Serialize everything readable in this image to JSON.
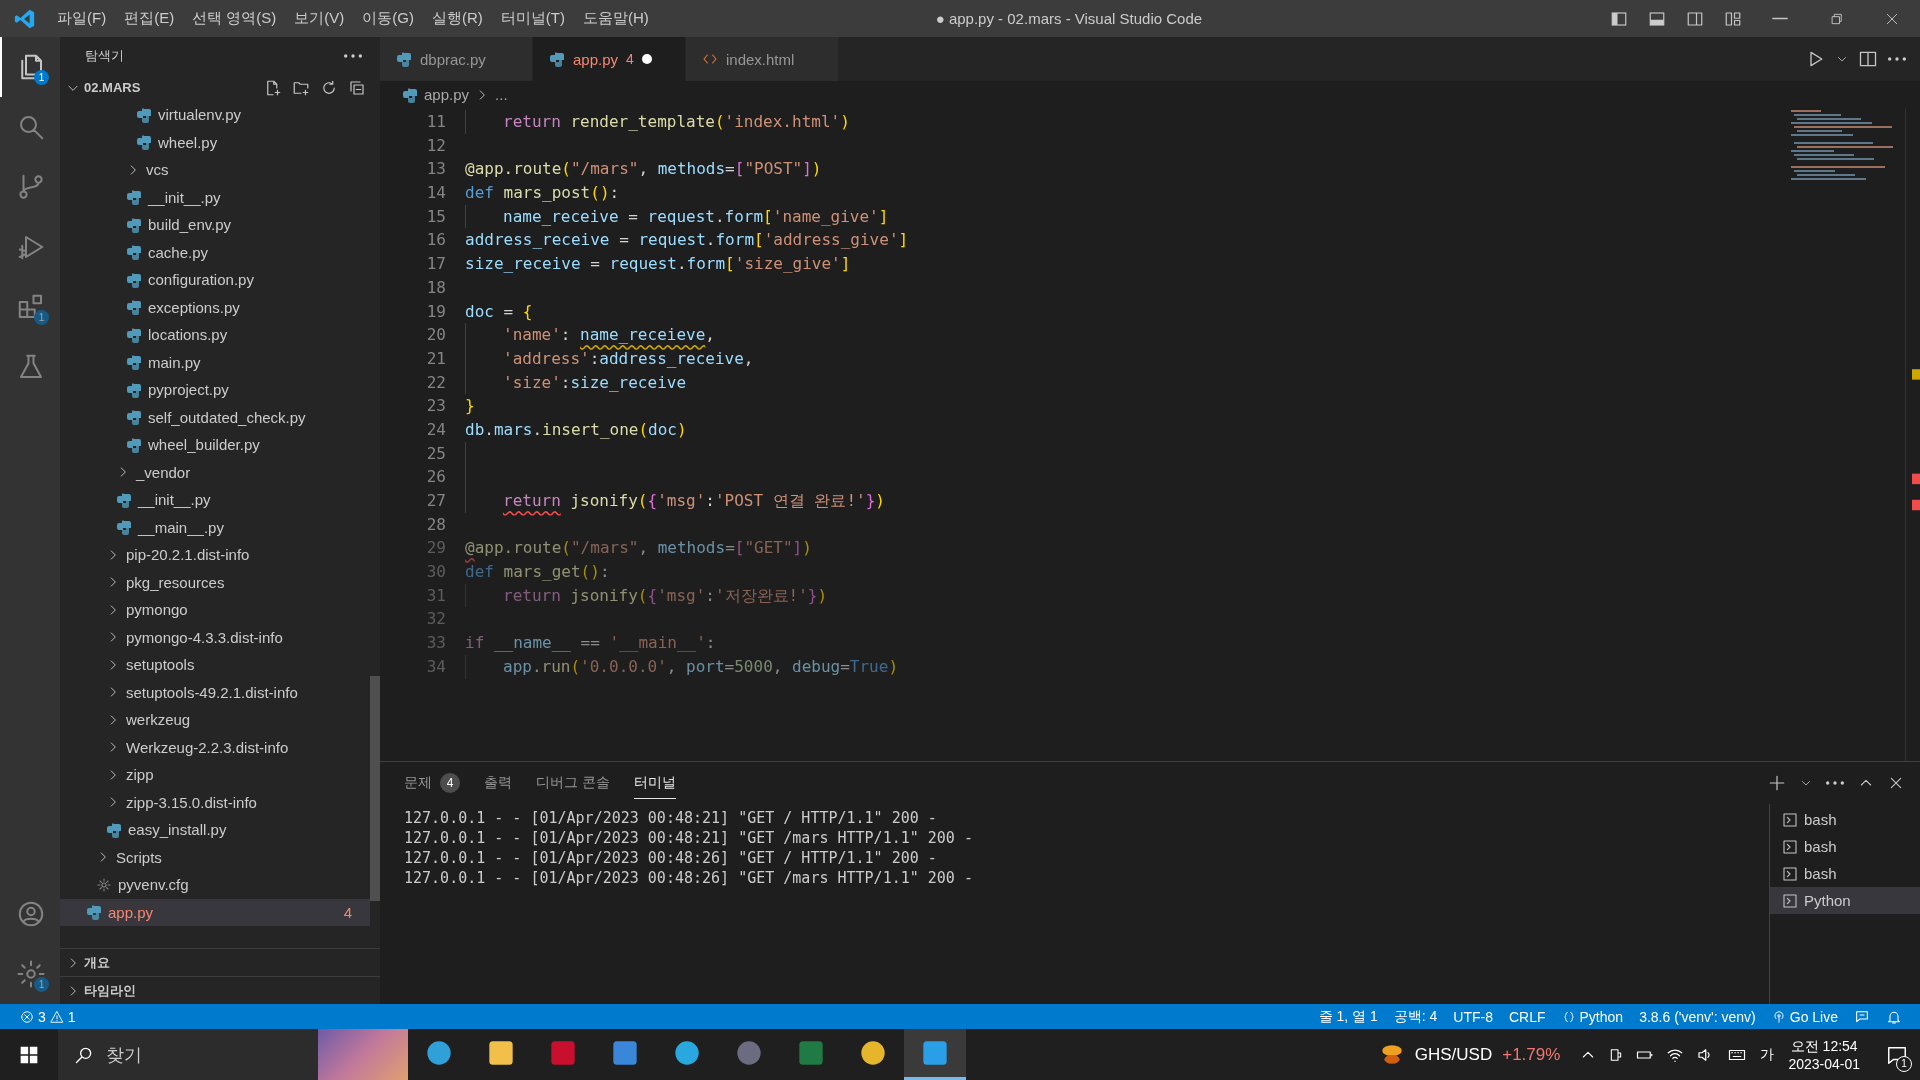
{
  "title_bar": {
    "menus": [
      "파일(F)",
      "편집(E)",
      "선택 영역(S)",
      "보기(V)",
      "이동(G)",
      "실행(R)",
      "터미널(T)",
      "도움말(H)"
    ],
    "title": "● app.py - 02.mars - Visual Studio Code"
  },
  "activity_bar": [
    {
      "kind": "explorer",
      "selected": true,
      "badge": "1"
    },
    {
      "kind": "search",
      "selected": false
    },
    {
      "kind": "source-control",
      "selected": false
    },
    {
      "kind": "run",
      "selected": false
    },
    {
      "kind": "extensions",
      "selected": false,
      "badge": "1"
    },
    {
      "kind": "testing",
      "selected": false
    }
  ],
  "activity_bar_bottom": [
    {
      "kind": "accounts"
    },
    {
      "kind": "manage",
      "badge": "1"
    }
  ],
  "explorer": {
    "title": "탐색기",
    "folder": "02.MARS",
    "tree": [
      {
        "children": [
          {
            "children": [
              {
                "children": [
                  {
                    "children": [
                      {
                        "children": [
                          {
                            "label": "virtualenv.py",
                            "kind": "python",
                            "selected": false
                          },
                          {
                            "label": "wheel.py",
                            "kind": "python",
                            "selected": false
                          }
                        ]
                      },
                      {
                        "label": "vcs",
                        "kind": "folder",
                        "selected": false
                      },
                      {
                        "label": "__init__.py",
                        "kind": "python",
                        "selected": false
                      },
                      {
                        "label": "build_env.py",
                        "kind": "python",
                        "selected": false
                      },
                      {
                        "label": "cache.py",
                        "kind": "python",
                        "selected": false
                      },
                      {
                        "label": "configuration.py",
                        "kind": "python",
                        "selected": false
                      },
                      {
                        "label": "exceptions.py",
                        "kind": "python",
                        "selected": false
                      },
                      {
                        "label": "locations.py",
                        "kind": "python",
                        "selected": false
                      },
                      {
                        "label": "main.py",
                        "kind": "python",
                        "selected": false
                      },
                      {
                        "label": "pyproject.py",
                        "kind": "python",
                        "selected": false
                      },
                      {
                        "label": "self_outdated_check.py",
                        "kind": "python",
                        "selected": false
                      },
                      {
                        "label": "wheel_builder.py",
                        "kind": "python",
                        "selected": false
                      }
                    ]
                  },
                  {
                    "label": "_vendor",
                    "kind": "folder",
                    "selected": false
                  },
                  {
                    "label": "__init__.py",
                    "kind": "python",
                    "selected": false
                  },
                  {
                    "label": "__main__.py",
                    "kind": "python",
                    "selected": false
                  }
                ]
              },
              {
                "label": "pip-20.2.1.dist-info",
                "kind": "folder",
                "selected": false
              },
              {
                "label": "pkg_resources",
                "kind": "folder",
                "selected": false
              },
              {
                "label": "pymongo",
                "kind": "folder",
                "selected": false
              },
              {
                "label": "pymongo-4.3.3.dist-info",
                "kind": "folder",
                "selected": false
              },
              {
                "label": "setuptools",
                "kind": "folder",
                "selected": false
              },
              {
                "label": "setuptools-49.2.1.dist-info",
                "kind": "folder",
                "selected": false
              },
              {
                "label": "werkzeug",
                "kind": "folder",
                "selected": false
              },
              {
                "label": "Werkzeug-2.2.3.dist-info",
                "kind": "folder",
                "selected": false
              },
              {
                "label": "zipp",
                "kind": "folder",
                "selected": false
              },
              {
                "label": "zipp-3.15.0.dist-info",
                "kind": "folder",
                "selected": false
              },
              {
                "label": "easy_install.py",
                "kind": "python",
                "selected": false
              }
            ]
          },
          {
            "label": "Scripts",
            "kind": "folder",
            "selected": false
          },
          {
            "label": "pyvenv.cfg",
            "kind": "config",
            "selected": false
          }
        ]
      },
      {
        "label": "app.py",
        "kind": "python",
        "selected": true,
        "badge": "4"
      }
    ],
    "sections": [
      "개요",
      "타임라인"
    ]
  },
  "tabs": [
    {
      "label": "dbprac.py",
      "kind": "python",
      "selected": false,
      "modified": false
    },
    {
      "label": "app.py",
      "kind": "python",
      "selected": true,
      "modified": true,
      "problems": "4"
    },
    {
      "label": "index.html",
      "kind": "html",
      "selected": false,
      "modified": false
    }
  ],
  "breadcrumb": [
    "app.py",
    "..."
  ],
  "code": [
    {
      "number": "11",
      "indented": true,
      "dimmed": false,
      "tokens": [
        {
          "text": "return",
          "kind": "control"
        },
        {
          "text": " render_template",
          "kind": "function"
        },
        {
          "text": "(",
          "kind": "bracket1"
        },
        {
          "text": "'index.html'",
          "kind": "string"
        },
        {
          "text": ")",
          "kind": "bracket1"
        }
      ]
    },
    {
      "number": "12",
      "indented": false,
      "dimmed": false
    },
    {
      "number": "13",
      "indented": false,
      "dimmed": false,
      "tokens": [
        {
          "text": "@app.route",
          "kind": "function"
        },
        {
          "text": "(",
          "kind": "bracket1"
        },
        {
          "text": "\"/mars\"",
          "kind": "string"
        },
        {
          "text": ", ",
          "kind": "plain"
        },
        {
          "text": "methods",
          "kind": "variable"
        },
        {
          "text": "=",
          "kind": "plain"
        },
        {
          "text": "[",
          "kind": "bracket2"
        },
        {
          "text": "\"POST\"",
          "kind": "string"
        },
        {
          "text": "]",
          "kind": "bracket2"
        },
        {
          "text": ")",
          "kind": "bracket1"
        }
      ]
    },
    {
      "number": "14",
      "indented": false,
      "dimmed": false,
      "tokens": [
        {
          "text": "def",
          "kind": "keyword"
        },
        {
          "text": " mars_post",
          "kind": "function"
        },
        {
          "text": "(",
          "kind": "bracket1"
        },
        {
          "text": ")",
          "kind": "bracket1"
        },
        {
          "text": ":",
          "kind": "plain"
        }
      ]
    },
    {
      "number": "15",
      "indented": true,
      "dimmed": false,
      "tokens": [
        {
          "text": "name_receive",
          "kind": "variable"
        },
        {
          "text": " = ",
          "kind": "plain"
        },
        {
          "text": "request",
          "kind": "variable"
        },
        {
          "text": ".",
          "kind": "plain"
        },
        {
          "text": "form",
          "kind": "variable"
        },
        {
          "text": "[",
          "kind": "bracket1"
        },
        {
          "text": "'name_give'",
          "kind": "string"
        },
        {
          "text": "]",
          "kind": "bracket1"
        }
      ]
    },
    {
      "number": "16",
      "indented": false,
      "dimmed": false,
      "tokens": [
        {
          "text": "address_receive",
          "kind": "variable"
        },
        {
          "text": " = ",
          "kind": "plain"
        },
        {
          "text": "request",
          "kind": "variable"
        },
        {
          "text": ".",
          "kind": "plain"
        },
        {
          "text": "form",
          "kind": "variable"
        },
        {
          "text": "[",
          "kind": "bracket1"
        },
        {
          "text": "'address_give'",
          "kind": "string"
        },
        {
          "text": "]",
          "kind": "bracket1"
        }
      ]
    },
    {
      "number": "17",
      "indented": false,
      "dimmed": false,
      "tokens": [
        {
          "text": "size_receive",
          "kind": "variable"
        },
        {
          "text": " = ",
          "kind": "plain"
        },
        {
          "text": "request",
          "kind": "variable"
        },
        {
          "text": ".",
          "kind": "plain"
        },
        {
          "text": "form",
          "kind": "variable"
        },
        {
          "text": "[",
          "kind": "bracket1"
        },
        {
          "text": "'size_give'",
          "kind": "string"
        },
        {
          "text": "]",
          "kind": "bracket1"
        }
      ]
    },
    {
      "number": "18",
      "indented": false,
      "dimmed": false
    },
    {
      "number": "19",
      "indented": false,
      "dimmed": false,
      "tokens": [
        {
          "text": "doc",
          "kind": "variable"
        },
        {
          "text": " = ",
          "kind": "plain"
        },
        {
          "text": "{",
          "kind": "bracket1"
        }
      ]
    },
    {
      "number": "20",
      "indented": true,
      "dimmed": false,
      "tokens": [
        {
          "text": "'name'",
          "kind": "string"
        },
        {
          "text": ": ",
          "kind": "plain"
        },
        {
          "text": "name_receieve",
          "kind": "variable",
          "warning": true
        },
        {
          "text": ",",
          "kind": "plain"
        }
      ]
    },
    {
      "number": "21",
      "indented": true,
      "dimmed": false,
      "tokens": [
        {
          "text": "'address'",
          "kind": "string"
        },
        {
          "text": ":",
          "kind": "plain"
        },
        {
          "text": "address_receive",
          "kind": "variable"
        },
        {
          "text": ",",
          "kind": "plain"
        }
      ]
    },
    {
      "number": "22",
      "indented": true,
      "dimmed": false,
      "tokens": [
        {
          "text": "'size'",
          "kind": "string"
        },
        {
          "text": ":",
          "kind": "plain"
        },
        {
          "text": "size_receive",
          "kind": "variable"
        }
      ]
    },
    {
      "number": "23",
      "indented": false,
      "dimmed": false,
      "tokens": [
        {
          "text": "}",
          "kind": "bracket1"
        }
      ]
    },
    {
      "number": "24",
      "indented": false,
      "dimmed": false,
      "tokens": [
        {
          "text": "db",
          "kind": "variable"
        },
        {
          "text": ".",
          "kind": "plain"
        },
        {
          "text": "mars",
          "kind": "variable"
        },
        {
          "text": ".",
          "kind": "plain"
        },
        {
          "text": "insert_one",
          "kind": "function"
        },
        {
          "text": "(",
          "kind": "bracket1"
        },
        {
          "text": "doc",
          "kind": "variable"
        },
        {
          "text": ")",
          "kind": "bracket1"
        }
      ]
    },
    {
      "number": "25",
      "indented": true,
      "dimmed": false
    },
    {
      "number": "26",
      "indented": true,
      "dimmed": false
    },
    {
      "number": "27",
      "indented": true,
      "dimmed": false,
      "tokens": [
        {
          "text": "return",
          "kind": "control",
          "error": true
        },
        {
          "text": " jsonify",
          "kind": "function"
        },
        {
          "text": "(",
          "kind": "bracket1"
        },
        {
          "text": "{",
          "kind": "bracket2"
        },
        {
          "text": "'msg'",
          "kind": "string"
        },
        {
          "text": ":",
          "kind": "plain"
        },
        {
          "text": "'POST 연결 완료!'",
          "kind": "string"
        },
        {
          "text": "}",
          "kind": "bracket2"
        },
        {
          "text": ")",
          "kind": "bracket1"
        }
      ]
    },
    {
      "number": "28",
      "indented": false,
      "dimmed": false
    },
    {
      "number": "29",
      "indented": false,
      "dimmed": true,
      "tokens": [
        {
          "text": "@",
          "kind": "function",
          "error": true
        },
        {
          "text": "app.route",
          "kind": "function"
        },
        {
          "text": "(",
          "kind": "bracket1"
        },
        {
          "text": "\"/mars\"",
          "kind": "string"
        },
        {
          "text": ", ",
          "kind": "plain"
        },
        {
          "text": "methods",
          "kind": "variable"
        },
        {
          "text": "=",
          "kind": "plain"
        },
        {
          "text": "[",
          "kind": "bracket2"
        },
        {
          "text": "\"GET\"",
          "kind": "string"
        },
        {
          "text": "]",
          "kind": "bracket2"
        },
        {
          "text": ")",
          "kind": "bracket1"
        }
      ]
    },
    {
      "number": "30",
      "indented": false,
      "dimmed": true,
      "tokens": [
        {
          "text": "def",
          "kind": "keyword"
        },
        {
          "text": " mars_get",
          "kind": "function"
        },
        {
          "text": "(",
          "kind": "bracket1"
        },
        {
          "text": ")",
          "kind": "bracket1"
        },
        {
          "text": ":",
          "kind": "plain"
        }
      ]
    },
    {
      "number": "31",
      "indented": true,
      "dimmed": true,
      "tokens": [
        {
          "text": "return",
          "kind": "control"
        },
        {
          "text": " jsonify",
          "kind": "function"
        },
        {
          "text": "(",
          "kind": "bracket1"
        },
        {
          "text": "{",
          "kind": "bracket2"
        },
        {
          "text": "'msg'",
          "kind": "string"
        },
        {
          "text": ":",
          "kind": "plain"
        },
        {
          "text": "'저장완료!'",
          "kind": "string"
        },
        {
          "text": "}",
          "kind": "bracket2"
        },
        {
          "text": ")",
          "kind": "bracket1"
        }
      ]
    },
    {
      "number": "32",
      "indented": false,
      "dimmed": true
    },
    {
      "number": "33",
      "indented": false,
      "dimmed": true,
      "tokens": [
        {
          "text": "if",
          "kind": "control"
        },
        {
          "text": " __name__",
          "kind": "variable"
        },
        {
          "text": " == ",
          "kind": "plain"
        },
        {
          "text": "'__main__'",
          "kind": "string"
        },
        {
          "text": ":",
          "kind": "plain"
        }
      ]
    },
    {
      "number": "34",
      "indented": true,
      "dimmed": true,
      "tokens": [
        {
          "text": "app",
          "kind": "variable"
        },
        {
          "text": ".",
          "kind": "plain"
        },
        {
          "text": "run",
          "kind": "function"
        },
        {
          "text": "(",
          "kind": "bracket1"
        },
        {
          "text": "'0.0.0.0'",
          "kind": "string"
        },
        {
          "text": ", ",
          "kind": "plain"
        },
        {
          "text": "port",
          "kind": "variable"
        },
        {
          "text": "=",
          "kind": "plain"
        },
        {
          "text": "5000",
          "kind": "number"
        },
        {
          "text": ", ",
          "kind": "plain"
        },
        {
          "text": "debug",
          "kind": "variable"
        },
        {
          "text": "=",
          "kind": "plain"
        },
        {
          "text": "True",
          "kind": "constant"
        },
        {
          "text": ")",
          "kind": "bracket1"
        }
      ]
    }
  ],
  "panel": {
    "tabs": [
      {
        "label": "문제",
        "selected": false,
        "badge": "4"
      },
      {
        "label": "출력",
        "selected": false
      },
      {
        "label": "디버그 콘솔",
        "selected": false
      },
      {
        "label": "터미널",
        "selected": true
      }
    ],
    "terminal_lines": [
      "127.0.0.1 - - [01/Apr/2023 00:48:21] \"GET / HTTP/1.1\" 200 -",
      "127.0.0.1 - - [01/Apr/2023 00:48:21] \"GET /mars HTTP/1.1\" 200 -",
      "127.0.0.1 - - [01/Apr/2023 00:48:26] \"GET / HTTP/1.1\" 200 -",
      "127.0.0.1 - - [01/Apr/2023 00:48:26] \"GET /mars HTTP/1.1\" 200 -"
    ],
    "terminals": [
      {
        "label": "bash",
        "selected": false
      },
      {
        "label": "bash",
        "selected": false
      },
      {
        "label": "bash",
        "selected": false
      },
      {
        "label": "Python",
        "selected": true
      }
    ]
  },
  "status_bar": {
    "errors": "3",
    "warnings": "1",
    "items": [
      {
        "kind": "text",
        "text": "줄 1, 열 1"
      },
      {
        "kind": "text",
        "text": "공백: 4"
      },
      {
        "kind": "text",
        "text": "UTF-8"
      },
      {
        "kind": "text",
        "text": "CRLF"
      },
      {
        "kind": "language",
        "text": "Python"
      },
      {
        "kind": "text",
        "text": "3.8.6 ('venv': venv)"
      },
      {
        "kind": "live",
        "text": "Go Live"
      },
      {
        "kind": "feedback"
      },
      {
        "kind": "notifications"
      }
    ]
  },
  "taskbar": {
    "search_placeholder": "찾기",
    "apps": [
      {
        "kind": "edge",
        "selected": false
      },
      {
        "kind": "files",
        "selected": false
      },
      {
        "kind": "shield",
        "selected": false
      },
      {
        "kind": "store",
        "selected": false
      },
      {
        "kind": "ie",
        "selected": false
      },
      {
        "kind": "sphere",
        "selected": false
      },
      {
        "kind": "excel",
        "selected": false
      },
      {
        "kind": "chrome",
        "selected": false
      },
      {
        "kind": "vscode",
        "selected": true
      }
    ],
    "ticker": {
      "symbol": "GHS/USD",
      "change": "+1.79%"
    },
    "ime": "가",
    "time": "오전 12:54",
    "date": "2023-04-01",
    "notification_count": "1"
  }
}
